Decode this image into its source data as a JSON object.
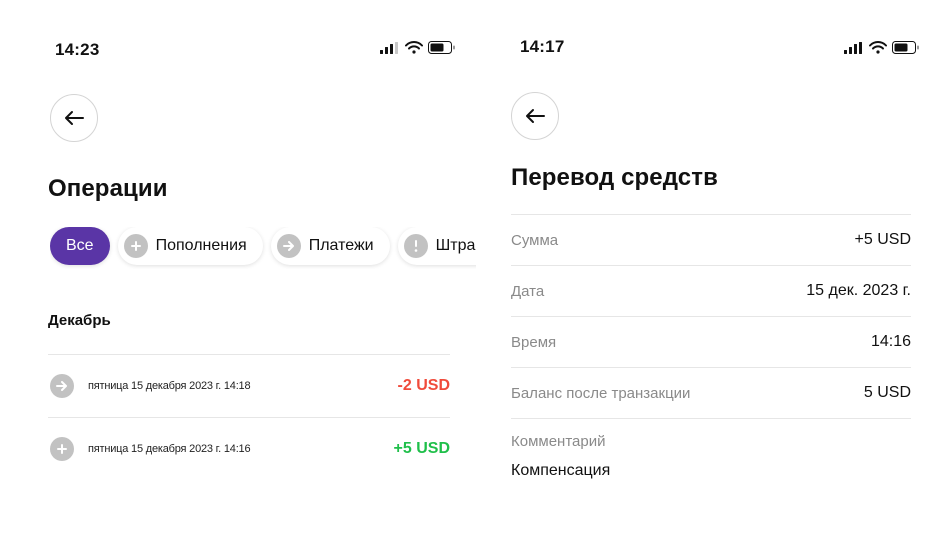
{
  "left_screen": {
    "status": {
      "time": "14:23"
    },
    "title": "Операции",
    "filters": [
      {
        "label": "Все",
        "active": true,
        "icon": ""
      },
      {
        "label": "Пополнения",
        "active": false,
        "icon": "plus-icon"
      },
      {
        "label": "Платежи",
        "active": false,
        "icon": "arrow-right-icon"
      },
      {
        "label": "Штрафы",
        "active": false,
        "icon": "exclamation-icon"
      }
    ],
    "month": "Декабрь",
    "operations": [
      {
        "date": "пятница 15 декабря 2023 г. 14:18",
        "amount": "-2 USD",
        "icon": "arrow-right-icon",
        "color": "#f04b3b"
      },
      {
        "date": "пятница 15 декабря 2023 г. 14:16",
        "amount": "+5 USD",
        "icon": "plus-icon",
        "color": "#1fbf4a"
      }
    ]
  },
  "right_screen": {
    "status": {
      "time": "14:17"
    },
    "title": "Перевод средств",
    "details": [
      {
        "label": "Сумма",
        "value": "+5 USD"
      },
      {
        "label": "Дата",
        "value": "15 дек. 2023 г."
      },
      {
        "label": "Время",
        "value": "14:16"
      },
      {
        "label": "Баланс после транзакции",
        "value": "5 USD"
      }
    ],
    "comment_label": "Комментарий",
    "comment_value": "Компенсация"
  },
  "colors": {
    "accent": "#5a35a6",
    "negative": "#f04b3b",
    "positive": "#1fbf4a",
    "icon_gray": "#c2c2c2"
  }
}
